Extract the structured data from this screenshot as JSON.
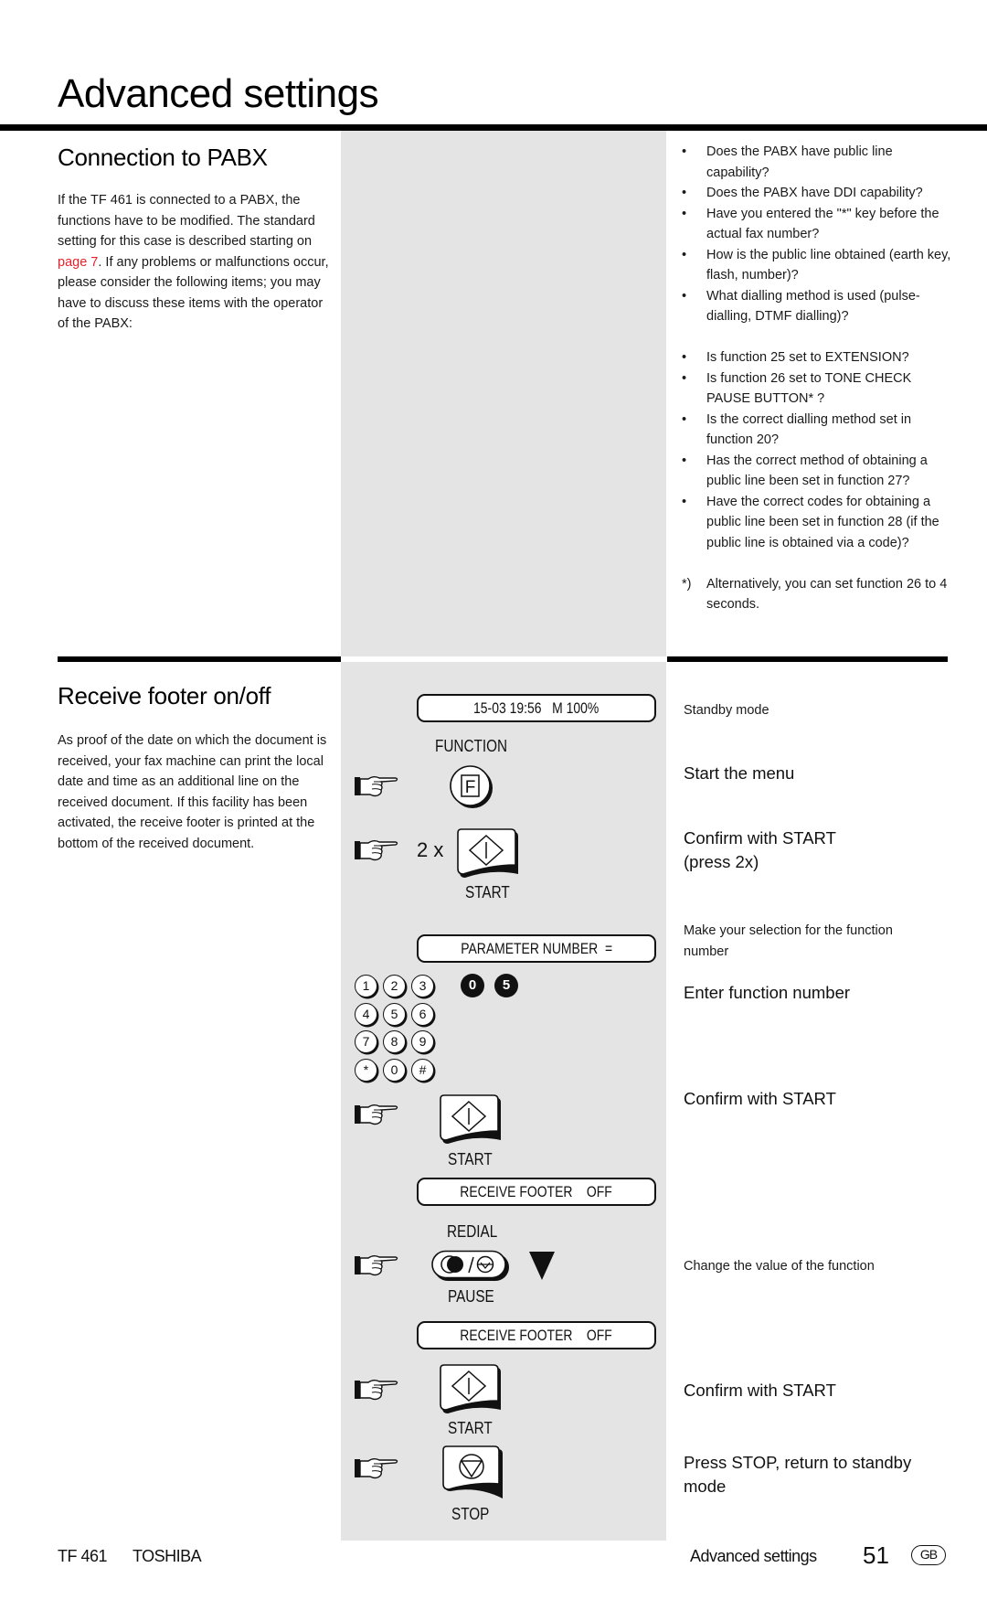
{
  "page": {
    "title": "Advanced settings"
  },
  "section1": {
    "heading": "Connection to PABX",
    "paragraph_before_link": "If the TF 461 is connected to a PABX, the functions have to be modified. The standard setting for this case is described starting on ",
    "link_text": "page 7",
    "paragraph_after_link": ". If any problems or malfunctions occur, please consider the following items; you may have to discuss these items with the operator of the PABX:",
    "bullets_group1": [
      "Does the PABX have public line capability?",
      "Does the PABX have DDI capability?",
      "Have you entered the \"*\" key before the actual fax number?",
      "How is the public line obtained (earth key, flash, number)?",
      "What dialling method is used (pulse-dialling, DTMF dialling)?"
    ],
    "bullets_group2": [
      "Is function 25 set to EXTENSION?",
      "Is function 26 set to TONE CHECK PAUSE BUTTON* ?",
      "Is the correct dialling method set in function 20?",
      "Has the correct method of obtaining a public line been set in function 27?",
      "Have the correct codes for obtaining a public line been set in function 28 (if the public line is obtained via a code)?"
    ],
    "bullet_mark": "•",
    "footnote_mark": "*)",
    "footnote": "Alternatively, you can set function 26 to 4 seconds."
  },
  "section2": {
    "heading": "Receive footer on/off",
    "paragraph": "As proof of the date on which the document is received, your fax machine can print the local date and time as an additional line on the received document. If this facility has been activated, the receive footer is printed at the bottom of the received document.",
    "panel": {
      "display_standby": "15-03 19:56   M 100%",
      "function_label": "FUNCTION",
      "function_key": "F",
      "press_count": "2 x",
      "start_label": "START",
      "display_parameter": "PARAMETER NUMBER  =",
      "keypad": [
        "1",
        "2",
        "3",
        "4",
        "5",
        "6",
        "7",
        "8",
        "9",
        "*",
        "0",
        "#"
      ],
      "entered_digits": [
        "0",
        "5"
      ],
      "display_footer_1": "RECEIVE FOOTER    OFF",
      "redial_label": "REDIAL",
      "pause_label": "PAUSE",
      "display_footer_2": "RECEIVE FOOTER    OFF",
      "stop_label": "STOP"
    },
    "steps": {
      "standby": "Standby mode",
      "start_menu": "Start the menu",
      "confirm_2x_line1": "Confirm with START",
      "confirm_2x_line2": "(press 2x)",
      "make_selection": "Make your selection for the function number",
      "enter_function": "Enter function number",
      "confirm_1": "Confirm with START",
      "change_value": "Change the value of the function",
      "confirm_2": "Confirm with START",
      "press_stop": "Press STOP, return to standby mode"
    }
  },
  "footer": {
    "model": "TF 461",
    "brand": "TOSHIBA",
    "section": "Advanced settings",
    "page_number": "51",
    "country_badge": "GB"
  }
}
